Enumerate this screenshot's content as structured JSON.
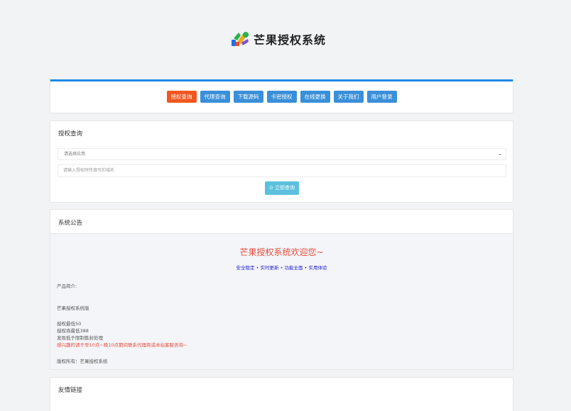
{
  "brand": {
    "title": "芒果授权系统",
    "colors": [
      "#1d6fe0",
      "#27b34a",
      "#f2a81d",
      "#7a4fd1"
    ]
  },
  "nav": {
    "items": [
      {
        "label": "授权查询",
        "active": true
      },
      {
        "label": "代理查询",
        "active": false
      },
      {
        "label": "下载源码",
        "active": false
      },
      {
        "label": "卡密授权",
        "active": false
      },
      {
        "label": "在线更换",
        "active": false
      },
      {
        "label": "关于我们",
        "active": false
      },
      {
        "label": "用户登录",
        "active": false
      }
    ],
    "accent": "#1e88e5",
    "active_color": "#f1571f"
  },
  "query": {
    "title": "授权查询",
    "select_value": "请选择应用",
    "input_placeholder": "请输入授权时所填写的域名",
    "button_label": "立即查询",
    "button_icon": "search-icon"
  },
  "notice": {
    "title": "系统公告",
    "welcome": "芒果授权系统欢迎您~",
    "slogan": "安全稳定 • 实时更新 • 功能全面 • 实用体验",
    "intro_label": "产品简介:",
    "product_name": "芒果授权系统版",
    "price_line1": "授权最低50",
    "price_line2": "授权商最低388",
    "price_line3": "发现低于限制售封处理",
    "contact_line": "感兴趣的请于早10点~晚10点期间联系代理商或本站客服咨询~",
    "copyright": "版权所有：芒果授权系统"
  },
  "links": {
    "title": "友情链接"
  }
}
